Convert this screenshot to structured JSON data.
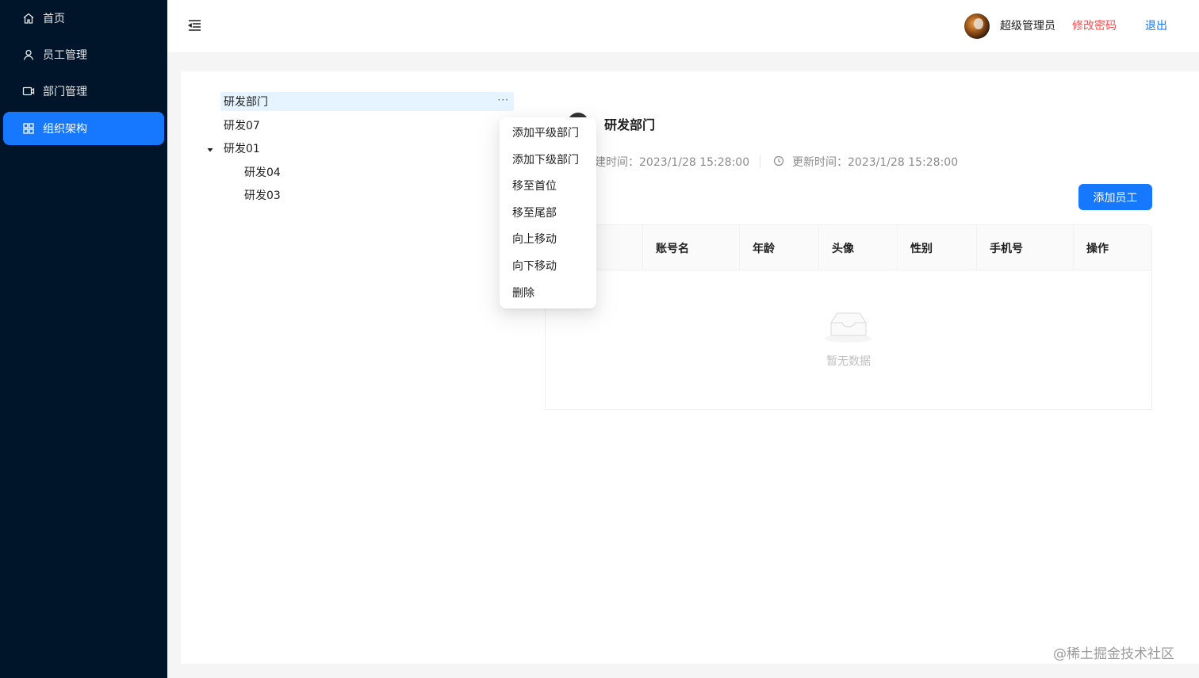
{
  "sidebar": {
    "items": [
      {
        "label": "首页",
        "icon": "home-icon"
      },
      {
        "label": "员工管理",
        "icon": "user-icon"
      },
      {
        "label": "部门管理",
        "icon": "video-camera-icon"
      },
      {
        "label": "组织架构",
        "icon": "apps-icon",
        "active": true
      }
    ]
  },
  "header": {
    "user_name": "超级管理员",
    "change_password": "修改密码",
    "logout": "退出"
  },
  "tree": {
    "nodes": [
      {
        "label": "研发部门",
        "selected": true
      },
      {
        "label": "研发07"
      },
      {
        "label": "研发01",
        "expanded": true
      },
      {
        "label": "研发04"
      },
      {
        "label": "研发03"
      }
    ],
    "more": "···"
  },
  "context_menu": {
    "items": [
      "添加平级部门",
      "添加下级部门",
      "移至首位",
      "移至尾部",
      "向上移动",
      "向下移动",
      "删除"
    ]
  },
  "department": {
    "title": "研发部门",
    "created": "建时间：2023/1/28 15:28:00",
    "updated": "更新时间：2023/1/28 15:28:00"
  },
  "toolbar": {
    "add_employee": "添加员工"
  },
  "table": {
    "columns": [
      "账号名",
      "年龄",
      "头像",
      "性别",
      "手机号",
      "操作"
    ],
    "empty_text": "暂无数据"
  },
  "watermark": "@稀土掘金技术社区",
  "colors": {
    "sidebar_bg": "#001529",
    "primary": "#1677ff",
    "danger": "#ff4d4f"
  }
}
